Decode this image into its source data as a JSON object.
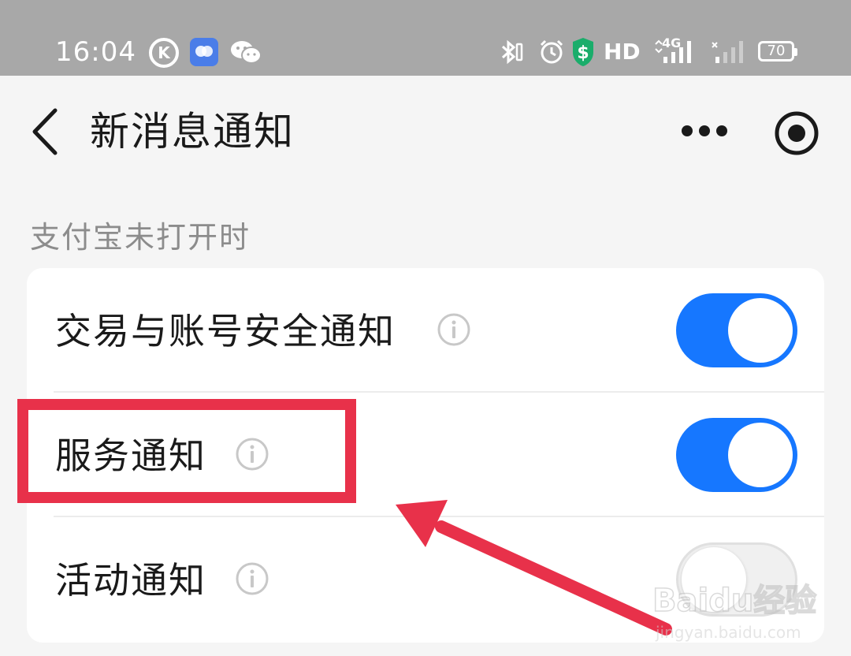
{
  "status_bar": {
    "time": "16:04",
    "k_icon_letter": "K",
    "hd_label": "HD",
    "network_type": "4G",
    "battery_level": "70",
    "icons": [
      "k-icon",
      "app-icon",
      "wechat-icon",
      "bluetooth-icon",
      "alarm-icon",
      "shield-icon",
      "signal-icon",
      "signal-empty-icon",
      "battery-icon"
    ]
  },
  "nav": {
    "title": "新消息通知",
    "back_icon": "chevron-left-icon",
    "more_icon": "more-icon",
    "record_icon": "record-icon"
  },
  "section": {
    "label": "支付宝未打开时"
  },
  "settings": [
    {
      "label": "交易与账号安全通知",
      "enabled": true
    },
    {
      "label": "服务通知",
      "enabled": true
    },
    {
      "label": "活动通知",
      "enabled": false
    }
  ],
  "colors": {
    "accent": "#1677ff",
    "annotation": "#e8314a",
    "status_bar": "#a8a8a8",
    "background": "#f5f5f5"
  },
  "watermark": {
    "brand": "Baidu经验",
    "url": "jingyan.baidu.com"
  }
}
